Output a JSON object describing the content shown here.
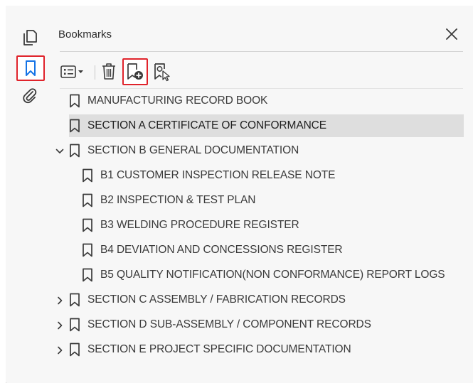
{
  "panel": {
    "title": "Bookmarks"
  },
  "rail": {
    "items": [
      {
        "icon": "pages-icon"
      },
      {
        "icon": "bookmark-icon"
      },
      {
        "icon": "paperclip-icon"
      }
    ]
  },
  "toolbar": {
    "items": [
      {
        "icon": "options-menu-icon"
      },
      {
        "icon": "trash-icon"
      },
      {
        "icon": "new-bookmark-icon"
      },
      {
        "icon": "bookmark-find-icon"
      }
    ]
  },
  "bookmarks": [
    {
      "label": "MANUFACTURING RECORD BOOK",
      "level": 0,
      "expander": "none"
    },
    {
      "label": "SECTION A CERTIFICATE OF CONFORMANCE",
      "level": 0,
      "expander": "none",
      "selected": true
    },
    {
      "label": "SECTION B GENERAL DOCUMENTATION",
      "level": 0,
      "expander": "expanded"
    },
    {
      "label": "B1 CUSTOMER INSPECTION RELEASE NOTE",
      "level": 1,
      "expander": "none"
    },
    {
      "label": "B2 INSPECTION & TEST PLAN",
      "level": 1,
      "expander": "none"
    },
    {
      "label": "B3 WELDING PROCEDURE REGISTER",
      "level": 1,
      "expander": "none"
    },
    {
      "label": "B4 DEVIATION AND CONCESSIONS REGISTER",
      "level": 1,
      "expander": "none"
    },
    {
      "label": "B5 QUALITY NOTIFICATION(NON CONFORMANCE) REPORT LOGS",
      "level": 1,
      "expander": "none"
    },
    {
      "label": "SECTION C ASSEMBLY / FABRICATION RECORDS",
      "level": 0,
      "expander": "collapsed"
    },
    {
      "label": "SECTION D SUB-ASSEMBLY / COMPONENT RECORDS",
      "level": 0,
      "expander": "collapsed"
    },
    {
      "label": "SECTION E PROJECT SPECIFIC DOCUMENTATION",
      "level": 0,
      "expander": "collapsed"
    }
  ],
  "colors": {
    "accent_blue": "#1473e6",
    "highlight_red": "#e0232b",
    "selected_row": "#dedede"
  }
}
